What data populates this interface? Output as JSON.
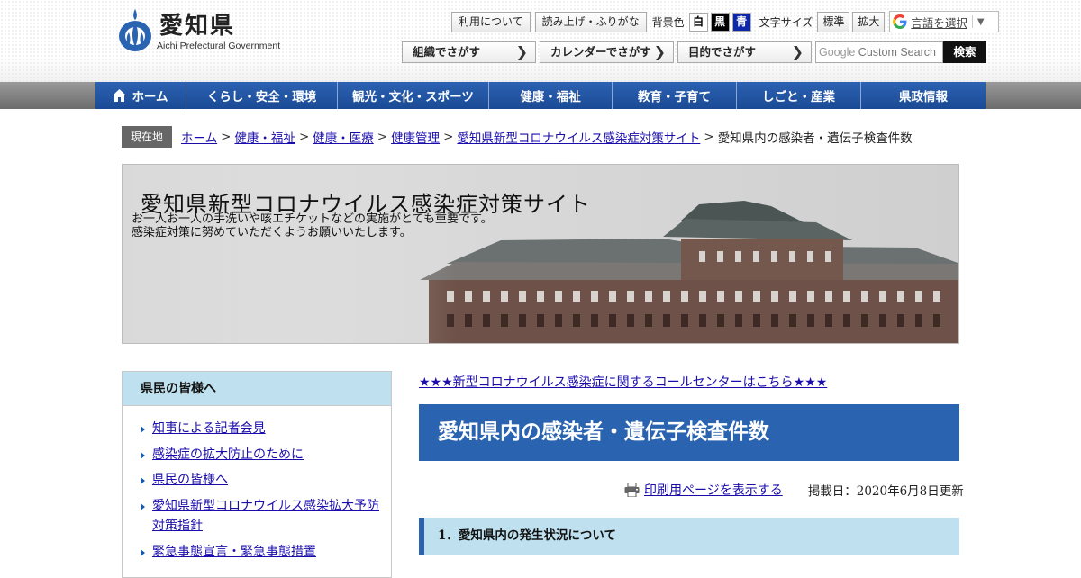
{
  "header": {
    "logo_name": "愛知県",
    "logo_en": "Aichi Prefectural Government",
    "tools": {
      "terms": "利用について",
      "readout": "読み上げ・ふりがな",
      "bg_label": "背景色",
      "bg_white": "白",
      "bg_black": "黒",
      "bg_blue": "青",
      "size_label": "文字サイズ",
      "size_standard": "標準",
      "size_large": "拡大",
      "translate": "言語を選択",
      "translate_arrow": "▼"
    },
    "search_buttons": [
      "組織でさがす",
      "カレンダーでさがす",
      "目的でさがす"
    ],
    "search_placeholder_brand": "Google",
    "search_placeholder": "Custom Search",
    "search_submit": "検索"
  },
  "nav": {
    "items": [
      "ホーム",
      "くらし・安全・環境",
      "観光・文化・スポーツ",
      "健康・福祉",
      "教育・子育て",
      "しごと・産業",
      "県政情報"
    ]
  },
  "breadcrumb": {
    "here_label": "現在地",
    "links": [
      "ホーム",
      "健康・福祉",
      "健康・医療",
      "健康管理",
      "愛知県新型コロナウイルス感染症対策サイト"
    ],
    "current": "愛知県内の感染者・遺伝子検査件数",
    "separator": ">"
  },
  "banner": {
    "title": "愛知県新型コロナウイルス感染症対策サイト",
    "line1": "お一人お一人の手洗いや咳エチケットなどの実施がとても重要です。",
    "line2": "感染症対策に努めていただくようお願いいたします。"
  },
  "sidebar": {
    "heading": "県民の皆様へ",
    "items": [
      "知事による記者会見",
      "感染症の拡大防止のために",
      "県民の皆様へ",
      "愛知県新型コロナウイルス感染拡大予防対策指針",
      "緊急事態宣言・緊急事態措置"
    ]
  },
  "main": {
    "notice": "★★★新型コロナウイルス感染症に関するコールセンターはこちら★★★",
    "title": "愛知県内の感染者・遺伝子検査件数",
    "print_link": "印刷用ページを表示する",
    "updated": "掲載日：2020年6月8日更新",
    "section1": "1．愛知県内の発生状況について"
  },
  "colors": {
    "nav_blue": "#2a63b0",
    "light_blue": "#bfe0ee",
    "link": "#1a0dab"
  }
}
